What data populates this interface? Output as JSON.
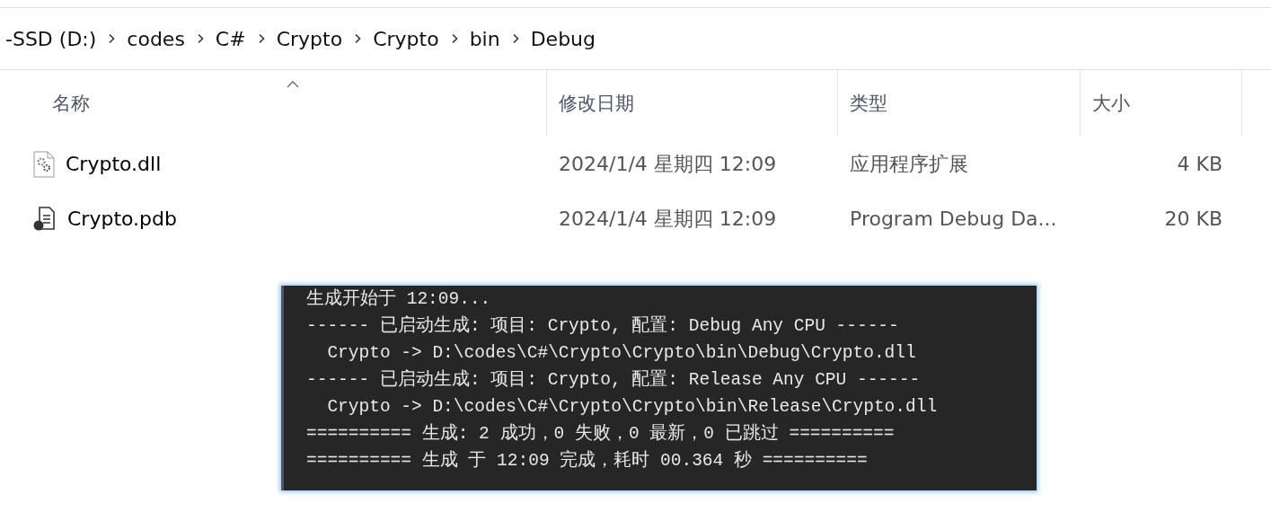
{
  "breadcrumb": [
    "-SSD (D:)",
    "codes",
    "C#",
    "Crypto",
    "Crypto",
    "bin",
    "Debug"
  ],
  "columns": [
    {
      "label": "名称",
      "sorted": true
    },
    {
      "label": "修改日期",
      "sorted": false
    },
    {
      "label": "类型",
      "sorted": false
    },
    {
      "label": "大小",
      "sorted": false
    }
  ],
  "files": [
    {
      "kind": "dll",
      "name": "Crypto.dll",
      "modified": "2024/1/4 星期四 12:09",
      "type": "应用程序扩展",
      "size": "4 KB"
    },
    {
      "kind": "pdb",
      "name": "Crypto.pdb",
      "modified": "2024/1/4 星期四 12:09",
      "type": "Program Debug Da...",
      "size": "20 KB"
    }
  ],
  "output_lines": [
    "生成开始于 12:09...",
    "------ 已启动生成: 项目: Crypto, 配置: Debug Any CPU ------",
    "  Crypto -> D:\\codes\\C#\\Crypto\\Crypto\\bin\\Debug\\Crypto.dll",
    "------ 已启动生成: 项目: Crypto, 配置: Release Any CPU ------",
    "  Crypto -> D:\\codes\\C#\\Crypto\\Crypto\\bin\\Release\\Crypto.dll",
    "========== 生成: 2 成功，0 失败，0 最新，0 已跳过 ==========",
    "========== 生成 于 12:09 完成，耗时 00.364 秒 =========="
  ]
}
